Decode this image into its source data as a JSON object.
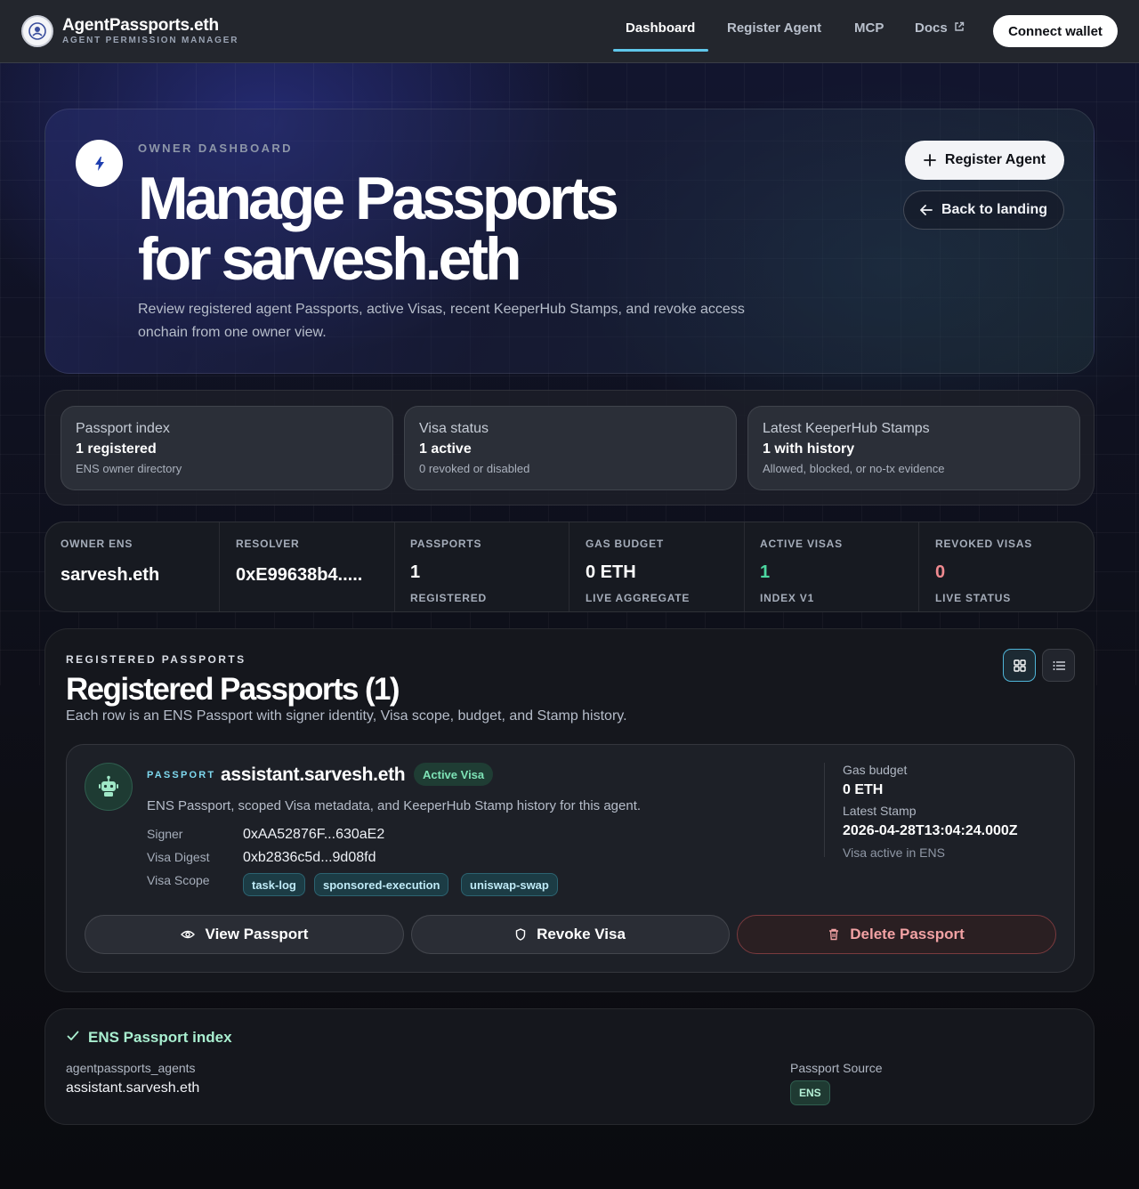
{
  "header": {
    "brand_title": "AgentPassports.eth",
    "brand_subtitle": "AGENT PERMISSION MANAGER",
    "nav": [
      {
        "label": "Dashboard",
        "active": true
      },
      {
        "label": "Register Agent",
        "active": false
      },
      {
        "label": "MCP",
        "active": false
      },
      {
        "label": "Docs",
        "active": false,
        "icon": "external-link-icon"
      }
    ],
    "connect_label": "Connect wallet"
  },
  "hero": {
    "eyebrow": "OWNER DASHBOARD",
    "title_line1": "Manage Passports",
    "title_line2": "for sarvesh.eth",
    "description": "Review registered agent Passports, active Visas, recent KeeperHub Stamps, and revoke access onchain from one owner view.",
    "register_label": "Register Agent",
    "back_label": "Back to landing",
    "icon": "lightning-icon"
  },
  "summary": [
    {
      "label": "Passport index",
      "value": "1 registered",
      "sub": "ENS owner directory"
    },
    {
      "label": "Visa status",
      "value": "1 active",
      "sub": "0 revoked or disabled"
    },
    {
      "label": "Latest KeeperHub Stamps",
      "value": "1 with history",
      "sub": "Allowed, blocked, or no-tx evidence"
    }
  ],
  "stats": [
    {
      "label": "OWNER ENS",
      "value": "sarvesh.eth",
      "sub": ""
    },
    {
      "label": "RESOLVER",
      "value": "0xE99638b4.....",
      "sub": ""
    },
    {
      "label": "PASSPORTS",
      "value": "1",
      "sub": "REGISTERED"
    },
    {
      "label": "GAS BUDGET",
      "value": "0 ETH",
      "sub": "LIVE AGGREGATE"
    },
    {
      "label": "ACTIVE VISAS",
      "value": "1",
      "sub": "INDEX V1"
    },
    {
      "label": "REVOKED VISAS",
      "value": "0",
      "sub": "LIVE STATUS"
    }
  ],
  "colors": {
    "active_visas": "#4cd7a0",
    "revoked_visas": "#f08a90",
    "accent": "#5fc6ea"
  },
  "passports": {
    "eyebrow": "REGISTERED PASSPORTS",
    "title": "Registered Passports (1)",
    "description": "Each row is an ENS Passport with signer identity, Visa scope, budget, and Stamp history.",
    "view_modes": [
      "grid-view-icon",
      "list-view-icon"
    ],
    "card": {
      "tag": "PASSPORT",
      "name": "assistant.sarvesh.eth",
      "badge": "Active Visa",
      "subtitle": "ENS Passport, scoped Visa metadata, and KeeperHub Stamp history for this agent.",
      "signer_label": "Signer",
      "signer": "0xAA52876F...630aE2",
      "digest_label": "Visa Digest",
      "digest": "0xb2836c5d...9d08fd",
      "scope_label": "Visa Scope",
      "scopes": [
        "task-log",
        "sponsored-execution",
        "uniswap-swap"
      ],
      "gas_label": "Gas budget",
      "gas_value": "0 ETH",
      "stamp_label": "Latest Stamp",
      "stamp_value": "2026-04-28T13:04:24.000Z",
      "status_note": "Visa active in ENS",
      "view_label": "View Passport",
      "revoke_label": "Revoke Visa",
      "delete_label": "Delete Passport"
    }
  },
  "ens_index": {
    "title": "ENS Passport index",
    "record_label": "agentpassports_agents",
    "record_value": "assistant.sarvesh.eth",
    "source_label": "Passport Source",
    "source_value": "ENS"
  }
}
